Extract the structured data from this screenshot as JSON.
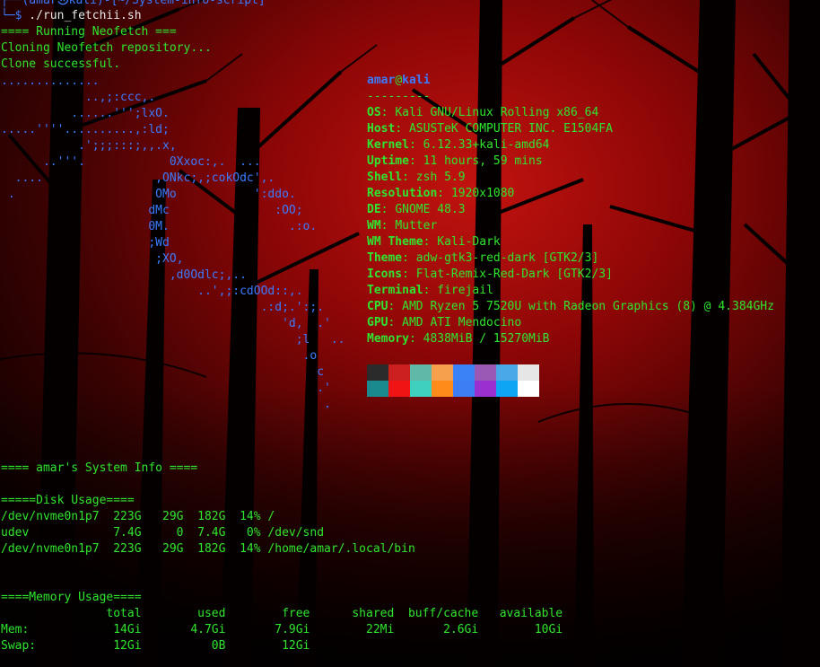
{
  "prompt": {
    "top": "┌──(amar㉿kali)-[~/System-info-script]",
    "symbol": "└─$",
    "command": " ./run_fetchii.sh"
  },
  "output_lines": [
    "==== Running Neofetch ===",
    "Cloning Neofetch repository...",
    "Clone successful."
  ],
  "ascii_logo": [
    "..............",
    "            ..,;:ccc,.",
    "          ......''';lxO.",
    ".....''''..........,:ld;",
    "           .';;;:::;,,.x,",
    "      ..'''.            0Xxoc:,.  ...",
    "  ....                ,ONkc;,;cokOdc',.",
    " .                    OMo           ':ddo.",
    "                     dMc               :OO;",
    "                     0M.                 .:o.",
    "                     ;Wd",
    "                      ;XO,",
    "                        ,d0Odlc;,..",
    "                            ..',;:cdOOd::,.",
    "                                     .:d;.':;.",
    "                                        'd,  .'",
    "                                          ;l   ..",
    "                                           .o",
    "                                             c",
    "                                             .'",
    "                                              ."
  ],
  "sysinfo": {
    "user": "amar",
    "at": "@",
    "host": "kali",
    "separator": "---------",
    "fields": [
      {
        "key": "OS",
        "value": "Kali GNU/Linux Rolling x86_64"
      },
      {
        "key": "Host",
        "value": "ASUSTeK COMPUTER INC. E1504FA"
      },
      {
        "key": "Kernel",
        "value": "6.12.33+kali-amd64"
      },
      {
        "key": "Uptime",
        "value": "11 hours, 59 mins"
      },
      {
        "key": "Shell",
        "value": "zsh 5.9"
      },
      {
        "key": "Resolution",
        "value": "1920x1080"
      },
      {
        "key": "DE",
        "value": "GNOME 48.3"
      },
      {
        "key": "WM",
        "value": "Mutter"
      },
      {
        "key": "WM Theme",
        "value": "Kali-Dark"
      },
      {
        "key": "Theme",
        "value": "adw-gtk3-red-dark [GTK2/3]"
      },
      {
        "key": "Icons",
        "value": "Flat-Remix-Red-Dark [GTK2/3]"
      },
      {
        "key": "Terminal",
        "value": "firejail"
      },
      {
        "key": "CPU",
        "value": "AMD Ryzen 5 7520U with Radeon Graphics (8) @ 4.384GHz"
      },
      {
        "key": "GPU",
        "value": "AMD ATI Mendocino"
      },
      {
        "key": "Memory",
        "value": "4838MiB / 15270MiB"
      }
    ]
  },
  "palette": {
    "row1": [
      "#2b2b2b",
      "#cc1f1f",
      "#5fb8a8",
      "#f6a04d",
      "#3b82f6",
      "#9b59b6",
      "#4aa8e8",
      "#e6e6e6"
    ],
    "row2": [
      "#1a8a8f",
      "#f01414",
      "#3fd0c0",
      "#ff8c1a",
      "#3d7ef5",
      "#9b30d0",
      "#0ea5f5",
      "#ffffff"
    ]
  },
  "report": {
    "title": "==== amar's System Info ====",
    "disk_header": "=====Disk Usage====",
    "disk_rows": [
      "/dev/nvme0n1p7  223G   29G  182G  14% /",
      "udev            7.4G     0  7.4G   0% /dev/snd",
      "/dev/nvme0n1p7  223G   29G  182G  14% /home/amar/.local/bin"
    ],
    "memory_header": "====Memory Usage====",
    "memory_columns": "               total        used        free      shared  buff/cache   available",
    "memory_rows": [
      "Mem:            14Gi       4.7Gi       7.9Gi        22Mi       2.6Gi        10Gi",
      "Swap:           12Gi          0B        12Gi"
    ]
  }
}
